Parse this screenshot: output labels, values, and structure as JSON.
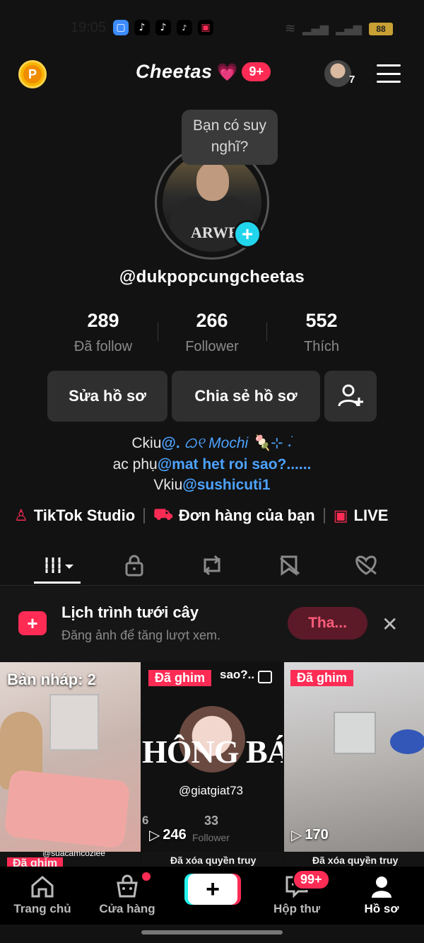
{
  "status_bar": {
    "time": "19:05",
    "battery": "88"
  },
  "header": {
    "title": "Cheetas",
    "title_emoji": "💗",
    "notif_badge": "9+",
    "avatar_count": "7",
    "coin_label": "P"
  },
  "profile": {
    "tooltip": "Bạn có suy nghĩ?",
    "username": "@dukpopcungcheetas",
    "shirt_text": "ARWE",
    "stats": [
      {
        "value": "289",
        "label": "Đã follow"
      },
      {
        "value": "266",
        "label": "Follower"
      },
      {
        "value": "552",
        "label": "Thích"
      }
    ],
    "buttons": {
      "edit": "Sửa hồ sơ",
      "share": "Chia sẻ hồ sơ"
    },
    "bio": {
      "line1_prefix": "Ckiu",
      "line1_link": "@.",
      "line1_mochi": " ᜊ୧ Mochi 🍡⊹ ࣪˖",
      "line2_prefix": "ac phụ",
      "line2_link": "@mat het roi sao?......",
      "line3_prefix": "Vkiu",
      "line3_link": "@sushicuti1"
    }
  },
  "links": {
    "studio": "TikTok Studio",
    "orders": "Đơn hàng của bạn",
    "live": "LIVE"
  },
  "promo": {
    "title": "Lịch trình tưới cây",
    "subtitle": "Đăng ảnh để tăng lượt xem.",
    "button": "Tha..."
  },
  "grid": {
    "draft_label": "Bản nháp: 2",
    "pinned_label": "Đã ghim",
    "video2_banner": "HÔNG BÁ",
    "video2_user": "@giatgiat73",
    "video2_top": "sao?..",
    "video2_stat_left": "6",
    "video2_stat_mid": "33",
    "video2_stat_mid_label": "Follower",
    "video2_views": "246",
    "video3_views": "170",
    "row2_left": "Đã ghim",
    "row2_left_user": "@suacamcozlee",
    "row2_mid": "Đã xóa quyền truy",
    "row2_right": "Đã xóa quyền truy"
  },
  "bottom_nav": {
    "home": "Trang chủ",
    "shop": "Cửa hàng",
    "inbox": "Hộp thư",
    "inbox_badge": "99+",
    "profile": "Hồ sơ"
  }
}
